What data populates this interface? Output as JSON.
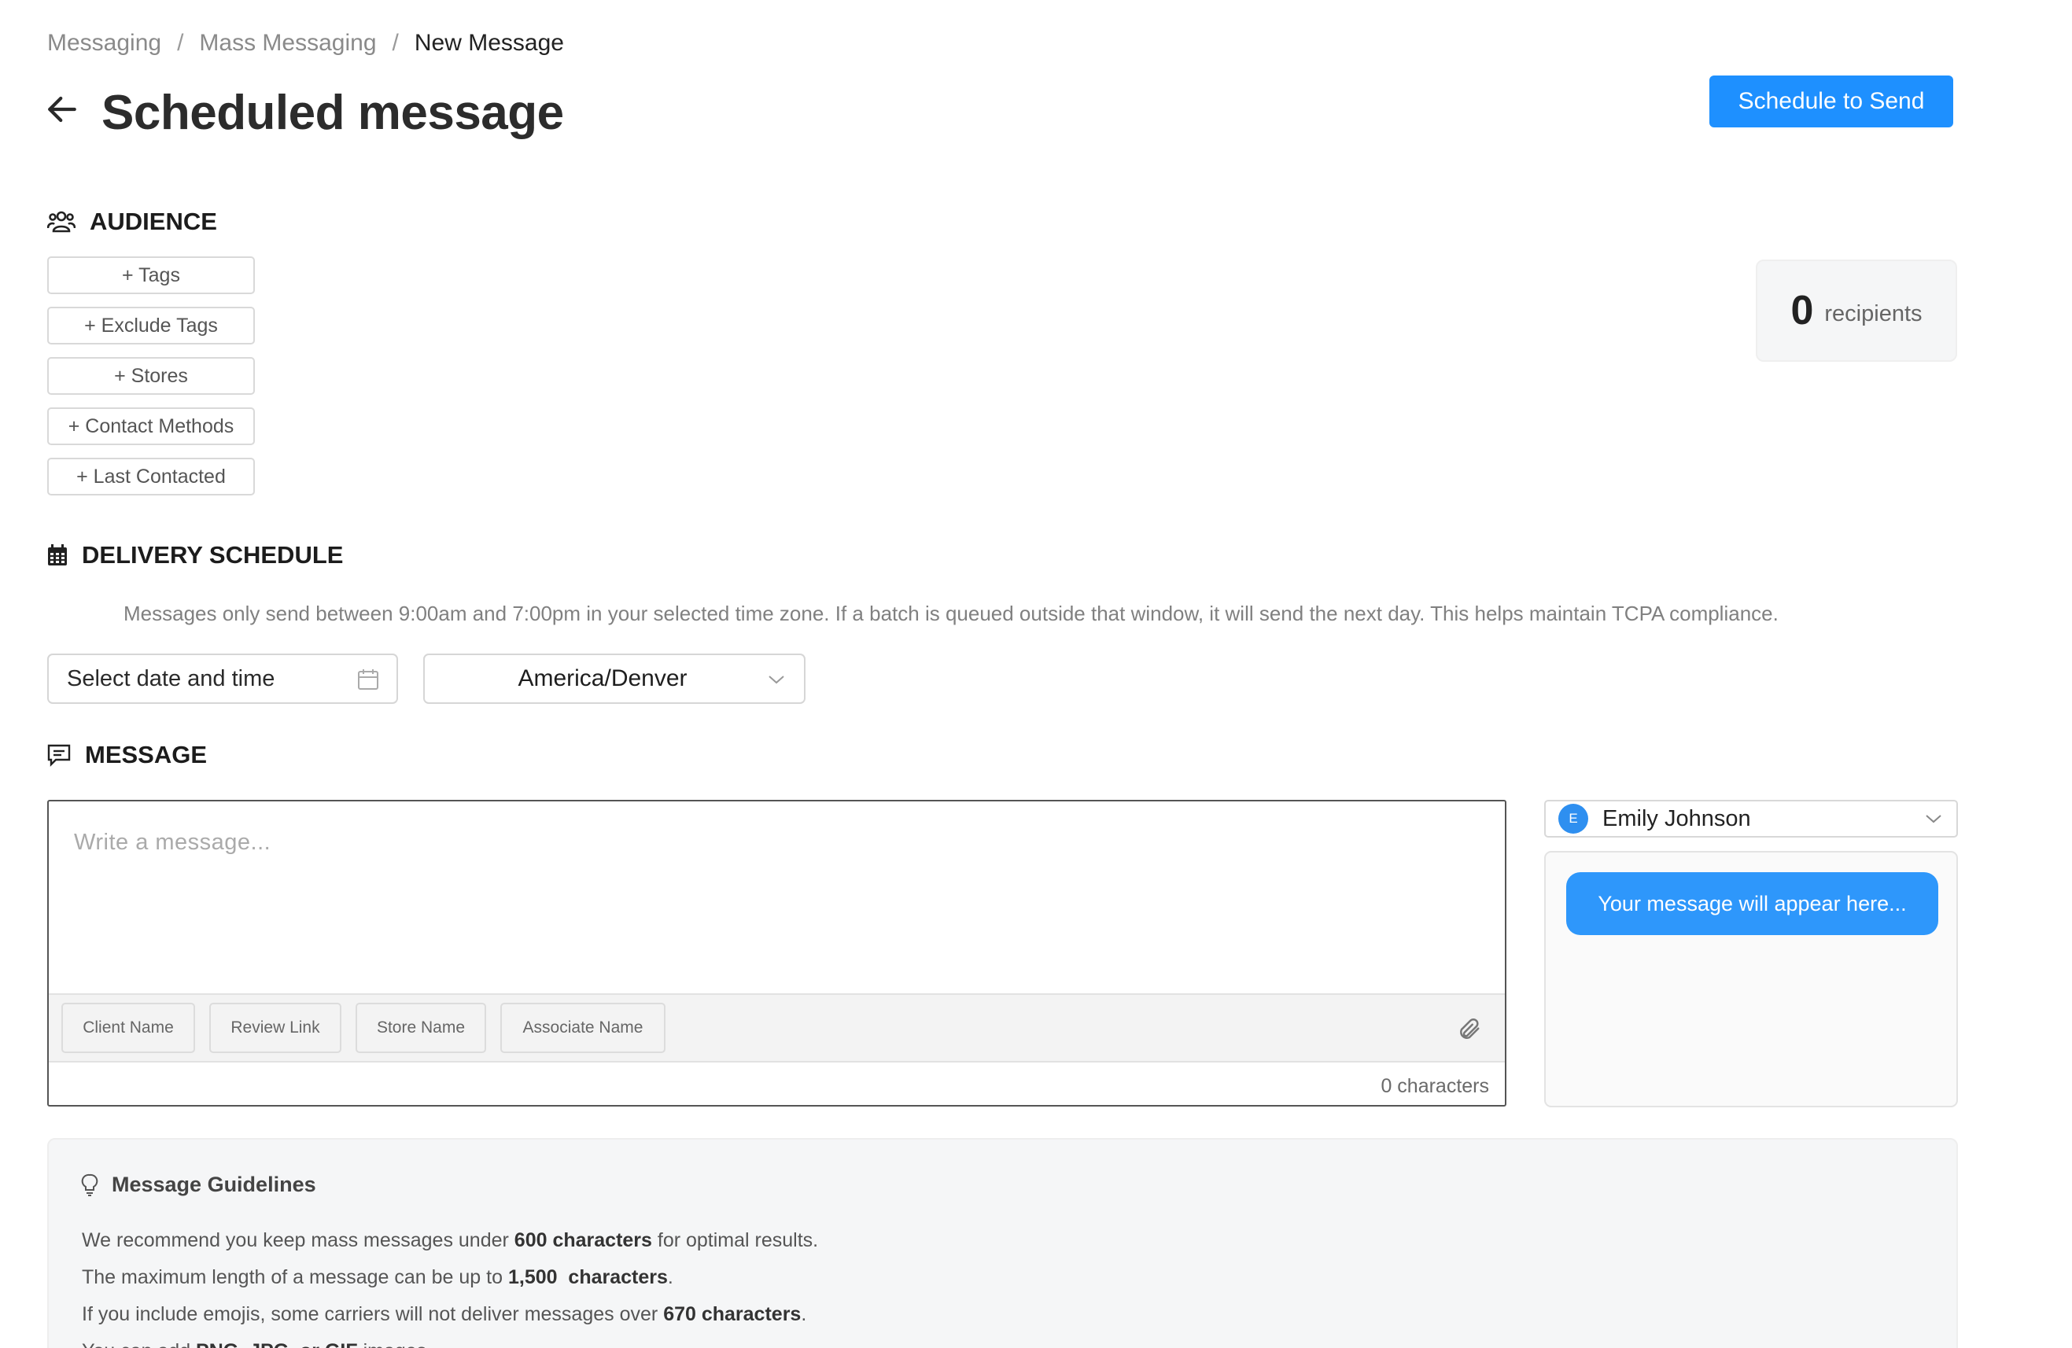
{
  "breadcrumb": {
    "items": [
      "Messaging",
      "Mass Messaging",
      "New Message"
    ],
    "separator": "/"
  },
  "header": {
    "title": "Scheduled message",
    "back_icon": "arrow-left-icon",
    "primary_action": "Schedule to Send"
  },
  "audience": {
    "heading": "AUDIENCE",
    "icon": "users-icon",
    "filters": [
      "+ Tags",
      "+ Exclude Tags",
      "+ Stores",
      "+ Contact Methods",
      "+ Last Contacted"
    ],
    "recipients_count": "0",
    "recipients_label": "recipients"
  },
  "delivery": {
    "heading": "DELIVERY SCHEDULE",
    "icon": "calendar-icon",
    "note": "Messages only send between 9:00am and 7:00pm in your selected time zone. If a batch is queued outside that window, it will send the next day. This helps maintain TCPA compliance.",
    "date_placeholder": "Select date and time",
    "timezone": "America/Denver"
  },
  "message": {
    "heading": "MESSAGE",
    "icon": "message-icon",
    "placeholder": "Write a message...",
    "chips": [
      "Client Name",
      "Review Link",
      "Store Name",
      "Associate Name"
    ],
    "char_count": "0 characters"
  },
  "preview": {
    "sender_initial": "E",
    "sender_name": "Emily Johnson",
    "bubble_text": "Your message will appear here..."
  },
  "guidelines": {
    "title": "Message Guidelines",
    "icon": "lightbulb-icon",
    "lines": [
      {
        "pre": "We recommend you keep mass messages under ",
        "bold": "600 characters",
        "post": " for optimal results."
      },
      {
        "pre": "The maximum length of a message can be up to ",
        "bold": "1,500  characters",
        "post": "."
      },
      {
        "pre": "If you include emojis, some carriers will not deliver messages over ",
        "bold": "670 characters",
        "post": "."
      },
      {
        "pre": "You can add ",
        "bold": "PNG, JPG, or GIF",
        "post": " images."
      }
    ]
  },
  "colors": {
    "primary": "#1e90ff",
    "bubble": "#2e97fb",
    "avatar": "#2e8ff0"
  }
}
